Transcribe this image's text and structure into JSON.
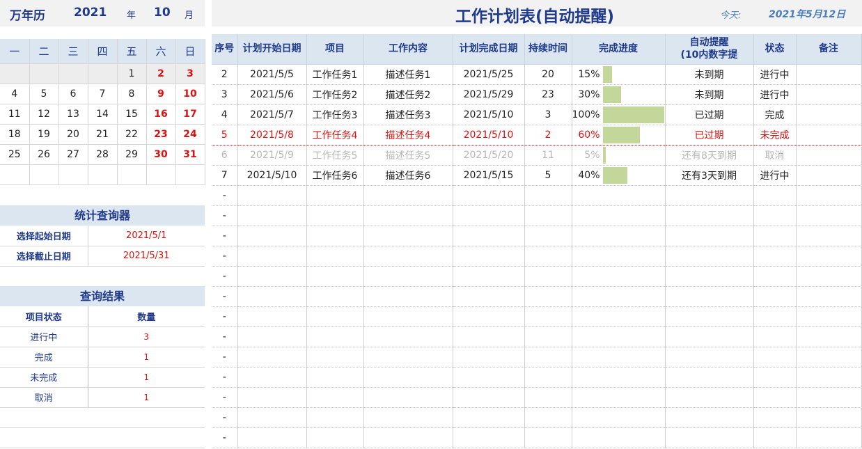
{
  "calendar_header": {
    "title": "万年历",
    "year": "2021",
    "year_label": "年",
    "month": "10",
    "month_label": "月"
  },
  "weekdays": [
    "一",
    "二",
    "三",
    "四",
    "五",
    "六",
    "日"
  ],
  "calendar_rows": [
    [
      "",
      "",
      "",
      "",
      "1",
      "2",
      "3"
    ],
    [
      "4",
      "5",
      "6",
      "7",
      "8",
      "9",
      "10"
    ],
    [
      "11",
      "12",
      "13",
      "14",
      "15",
      "16",
      "17"
    ],
    [
      "18",
      "19",
      "20",
      "21",
      "22",
      "23",
      "24"
    ],
    [
      "25",
      "26",
      "27",
      "28",
      "29",
      "30",
      "31"
    ],
    [
      "",
      "",
      "",
      "",
      "",
      "",
      ""
    ]
  ],
  "stats": {
    "title": "统计查询器",
    "start_label": "选择起始日期",
    "start_value": "2021/5/1",
    "end_label": "选择截止日期",
    "end_value": "2021/5/31"
  },
  "results": {
    "title": "查询结果",
    "col_status": "项目状态",
    "col_count": "数量",
    "rows": [
      {
        "status": "进行中",
        "count": "3"
      },
      {
        "status": "完成",
        "count": "1"
      },
      {
        "status": "未完成",
        "count": "1"
      },
      {
        "status": "取消",
        "count": "1"
      }
    ]
  },
  "main": {
    "title": "工作计划表(自动提醒)",
    "today_label": "今天:",
    "today_value": "2021年5月12日"
  },
  "columns": [
    "序号",
    "计划开始日期",
    "项目",
    "工作内容",
    "计划完成日期",
    "持续时间",
    "完成进度",
    "自动提醒\n(10内数字提",
    "状态",
    "备注"
  ],
  "tasks": [
    {
      "no": "2",
      "start": "2021/5/5",
      "item": "工作任务1",
      "content": "描述任务1",
      "end": "2021/5/25",
      "duration": "20",
      "progress": "15%",
      "progress_value": 0.15,
      "reminder": "未到期",
      "status": "进行中",
      "note": "",
      "style": "normal"
    },
    {
      "no": "3",
      "start": "2021/5/6",
      "item": "工作任务2",
      "content": "描述任务2",
      "end": "2021/5/29",
      "duration": "23",
      "progress": "30%",
      "progress_value": 0.3,
      "reminder": "未到期",
      "status": "进行中",
      "note": "",
      "style": "normal"
    },
    {
      "no": "4",
      "start": "2021/5/7",
      "item": "工作任务3",
      "content": "描述任务3",
      "end": "2021/5/10",
      "duration": "3",
      "progress": "100%",
      "progress_value": 1.0,
      "reminder": "已过期",
      "status": "完成",
      "note": "",
      "style": "normal"
    },
    {
      "no": "5",
      "start": "2021/5/8",
      "item": "工作任务4",
      "content": "描述任务4",
      "end": "2021/5/10",
      "duration": "2",
      "progress": "60%",
      "progress_value": 0.6,
      "reminder": "已过期",
      "status": "未完成",
      "note": "",
      "style": "red"
    },
    {
      "no": "6",
      "start": "2021/5/9",
      "item": "工作任务5",
      "content": "描述任务5",
      "end": "2021/5/20",
      "duration": "11",
      "progress": "5%",
      "progress_value": 0.05,
      "reminder": "还有8天到期",
      "status": "取消",
      "note": "",
      "style": "gray"
    },
    {
      "no": "7",
      "start": "2021/5/10",
      "item": "工作任务6",
      "content": "描述任务6",
      "end": "2021/5/15",
      "duration": "5",
      "progress": "40%",
      "progress_value": 0.4,
      "reminder": "还有3天到期",
      "status": "进行中",
      "note": "",
      "style": "normal"
    }
  ],
  "empty_row_marker": "-",
  "empty_row_count": 13,
  "colors": {
    "navy": "#1f3a8a",
    "red": "#e01010",
    "header_bg": "#dce6f1",
    "bar": "#c4d79b"
  }
}
